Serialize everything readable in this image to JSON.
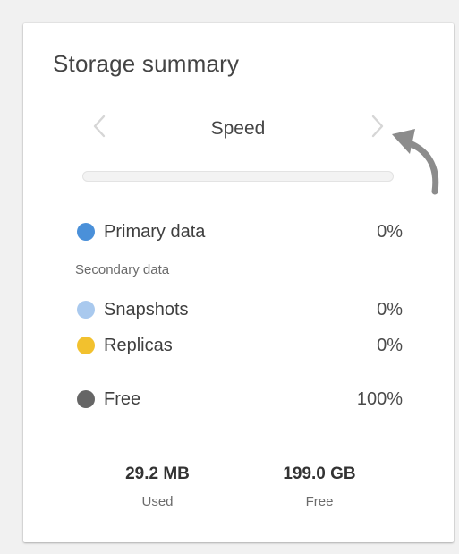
{
  "card": {
    "title": "Storage summary",
    "carousel": {
      "label": "Speed",
      "prev_icon": "chevron-left-icon",
      "next_icon": "chevron-right-icon"
    },
    "usage_bar": {
      "used_fraction": 0.0,
      "fill_color": "#4a90d9"
    },
    "items": [
      {
        "label": "Primary data",
        "value": "0%",
        "color": "#4a90d9"
      },
      {
        "label": "Snapshots",
        "value": "0%",
        "color": "#a9c9ee"
      },
      {
        "label": "Replicas",
        "value": "0%",
        "color": "#f2c12e"
      },
      {
        "label": "Free",
        "value": "100%",
        "color": "#666666"
      }
    ],
    "secondary_label": "Secondary data",
    "stats": {
      "used": {
        "value": "29.2 MB",
        "label": "Used"
      },
      "free": {
        "value": "199.0 GB",
        "label": "Free"
      }
    }
  }
}
